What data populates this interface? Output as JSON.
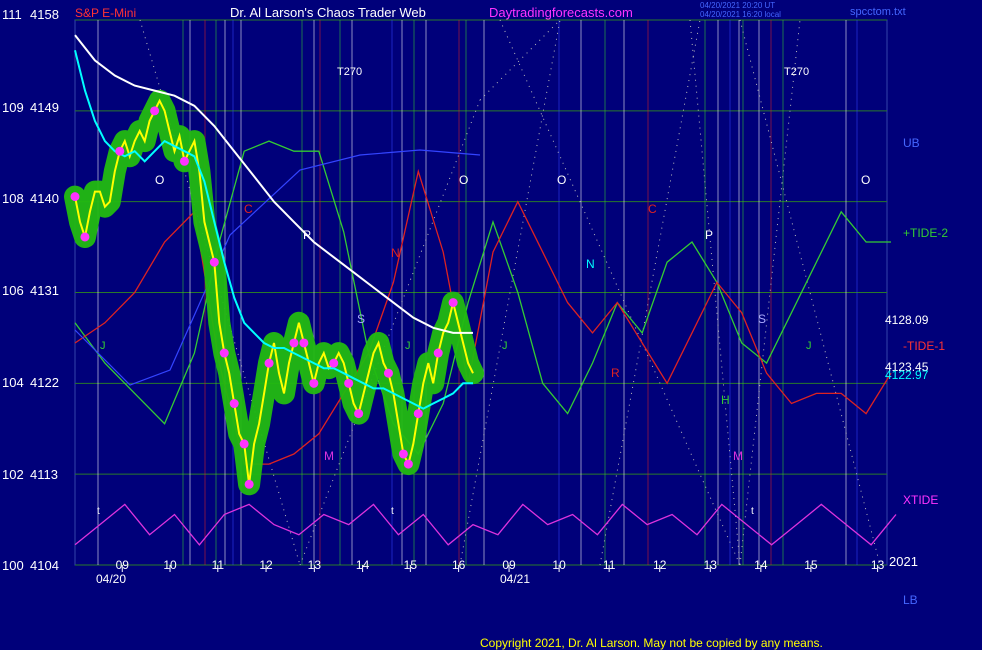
{
  "header": {
    "instrument": "S&P E-Mini",
    "site": "Dr. Al Larson's Chaos Trader Web",
    "url": "Daytradingforecasts.com",
    "timestamp1": "04/20/2021 20:20 UT",
    "timestamp2": "04/20/2021 16:20 local",
    "file": "spcctom.txt"
  },
  "footer": {
    "copyright": "Copyright 2021, Dr. Al Larson. May not be copied by any means."
  },
  "colors": {
    "background": "#00007a",
    "price_glow": "#22bb11",
    "price": "#ffff00",
    "ma_fast": "#00ffff",
    "ma_slow": "#ffffff",
    "tide_plus": "#33cc33",
    "tide_minus": "#dd2222",
    "xtide": "#dd33dd",
    "grid": "#2a7a2a",
    "blue": "#3344ff"
  },
  "chart_data": {
    "type": "line",
    "title": "S&P E-Mini",
    "y_axis": [
      {
        "label": "111",
        "price": 4158
      },
      {
        "label": "109",
        "price": 4149
      },
      {
        "label": "108",
        "price": 4140
      },
      {
        "label": "106",
        "price": 4131
      },
      {
        "label": "104",
        "price": 4122
      },
      {
        "label": "102",
        "price": 4113
      },
      {
        "label": "100",
        "price": 4104
      }
    ],
    "ylim": [
      4104,
      4158
    ],
    "xlim": [
      8.0,
      16.2
    ],
    "x_ticks": [
      "09",
      "10",
      "11",
      "12",
      "13",
      "14",
      "15",
      "16",
      "09",
      "10",
      "11",
      "12",
      "13",
      "14",
      "15",
      "13"
    ],
    "x_tick_hours": [
      8.95,
      9.91,
      10.87,
      11.84,
      12.81,
      13.78,
      14.74,
      15.71,
      8.95,
      9.91,
      10.87,
      11.84,
      12.81,
      13.78,
      14.74,
      16.02
    ],
    "x_tick_session": [
      0,
      0,
      0,
      0,
      0,
      0,
      0,
      0,
      1,
      1,
      1,
      1,
      1,
      1,
      1,
      1
    ],
    "dates": [
      "04/20",
      "04/21"
    ],
    "year": "2021",
    "right_labels": [
      "UB",
      "+TIDE-2",
      "4128.09",
      "-TIDE-1",
      "4123.45",
      "4122.97",
      "XTIDE",
      "LB"
    ],
    "markers": [
      "O",
      "O",
      "O",
      "O",
      "T270",
      "T270",
      "C",
      "C",
      "P",
      "P",
      "N",
      "N",
      "S",
      "S",
      "J",
      "J",
      "J",
      "J",
      "R",
      "H",
      "M",
      "M",
      "t",
      "t",
      "t"
    ],
    "series": [
      {
        "name": "price",
        "x": [
          8.0,
          8.1,
          8.2,
          8.3,
          8.4,
          8.5,
          8.6,
          8.7,
          8.8,
          8.9,
          9.0,
          9.1,
          9.2,
          9.3,
          9.4,
          9.5,
          9.6,
          9.7,
          9.8,
          9.9,
          10.0,
          10.1,
          10.2,
          10.3,
          10.4,
          10.5,
          10.6,
          10.7,
          10.8,
          10.9,
          11.0,
          11.1,
          11.2,
          11.3,
          11.4,
          11.5,
          11.6,
          11.7,
          11.8,
          11.9,
          12.0,
          12.1,
          12.2,
          12.3,
          12.4,
          12.5,
          12.6,
          12.7,
          12.8,
          12.9,
          13.0,
          13.1,
          13.2,
          13.3,
          13.4,
          13.5,
          13.6,
          13.7,
          13.8,
          13.9,
          14.0,
          14.1,
          14.2,
          14.3,
          14.4,
          14.5,
          14.6,
          14.7,
          14.8,
          14.9,
          15.0,
          15.1,
          15.2,
          15.3,
          15.4,
          15.5,
          15.6,
          15.7,
          15.8,
          15.9,
          16.0
        ],
        "values": [
          4140.5,
          4138,
          4136.5,
          4139,
          4141,
          4141,
          4139.5,
          4140,
          4143,
          4145,
          4146,
          4144.5,
          4146,
          4147,
          4146,
          4148,
          4149,
          4150,
          4149,
          4147,
          4145,
          4146.5,
          4144,
          4145,
          4146,
          4143,
          4138,
          4136,
          4134,
          4128,
          4125,
          4123,
          4120,
          4117,
          4116,
          4112,
          4116,
          4118,
          4121,
          4124,
          4126,
          4123,
          4121,
          4124,
          4126,
          4128,
          4126,
          4124,
          4122,
          4124,
          4125,
          4123.5,
          4124,
          4125,
          4124,
          4122,
          4120,
          4119,
          4121,
          4123,
          4125,
          4126,
          4124,
          4123,
          4121,
          4118,
          4115,
          4114,
          4116,
          4119,
          4122,
          4124,
          4122,
          4125,
          4127,
          4128,
          4130,
          4128,
          4126,
          4124,
          4123
        ]
      },
      {
        "name": "fast moving average",
        "x": [
          8.0,
          8.2,
          8.4,
          8.6,
          8.8,
          9.0,
          9.2,
          9.4,
          9.6,
          9.8,
          10.0,
          10.2,
          10.4,
          10.6,
          10.8,
          11.0,
          11.2,
          11.4,
          11.6,
          11.8,
          12.0,
          12.2,
          12.4,
          12.6,
          12.8,
          13.0,
          13.2,
          13.4,
          13.6,
          13.8,
          14.0,
          14.2,
          14.4,
          14.6,
          14.8,
          15.0,
          15.2,
          15.4,
          15.6,
          15.8,
          16.0
        ],
        "values": [
          4155,
          4151,
          4148,
          4146,
          4145,
          4144.5,
          4145,
          4144,
          4145,
          4146,
          4145.5,
          4145,
          4144.5,
          4142,
          4138,
          4134,
          4130.5,
          4128,
          4127,
          4126,
          4125.5,
          4125.5,
          4125,
          4124.5,
          4124,
          4123.5,
          4123.5,
          4123,
          4122.5,
          4122,
          4121.5,
          4121.5,
          4121,
          4120.5,
          4120,
          4119.5,
          4120,
          4120.5,
          4121,
          4122,
          4122
        ]
      },
      {
        "name": "slow moving average",
        "x": [
          8.0,
          8.4,
          8.8,
          9.2,
          9.6,
          10.0,
          10.4,
          10.8,
          11.2,
          11.6,
          12.0,
          12.4,
          12.8,
          13.2,
          13.6,
          14.0,
          14.4,
          14.8,
          15.2,
          15.6,
          16.0
        ],
        "values": [
          4156.5,
          4154,
          4152.5,
          4151.5,
          4151,
          4150.5,
          4149.5,
          4147.5,
          4145,
          4142.5,
          4140,
          4138,
          4136,
          4134.5,
          4133,
          4131.5,
          4130,
          4128.5,
          4127.5,
          4127,
          4127
        ]
      },
      {
        "name": "+TIDE-2",
        "x": [
          8.0,
          8.6,
          9.2,
          9.8,
          10.4,
          10.9,
          11.4,
          11.9,
          12.4,
          12.9,
          13.4,
          13.9,
          14.4,
          14.9,
          15.4,
          15.9,
          16.4,
          16.9,
          17.4,
          17.9,
          18.4,
          18.9,
          19.4,
          19.9,
          20.4,
          20.9,
          21.4,
          21.9,
          22.4,
          22.9,
          23.4,
          23.9,
          24.4
        ],
        "values": [
          4128,
          4124,
          4121,
          4118,
          4125,
          4136,
          4145,
          4146,
          4145,
          4145,
          4137,
          4125,
          4118,
          4115,
          4120,
          4130,
          4138,
          4131,
          4122,
          4119,
          4124,
          4130,
          4127,
          4134,
          4136,
          4132,
          4126,
          4124,
          4129,
          4134,
          4139,
          4136,
          4136
        ]
      },
      {
        "name": "-TIDE-1",
        "x": [
          8.0,
          8.6,
          9.2,
          9.8,
          10.4,
          10.9,
          11.4,
          11.9,
          12.4,
          12.9,
          13.4,
          13.9,
          14.4,
          14.9,
          15.4,
          15.9,
          16.4,
          16.9,
          17.4,
          17.9,
          18.4,
          18.9,
          19.4,
          19.9,
          20.4,
          20.9,
          21.4,
          21.9,
          22.4,
          22.9,
          23.4,
          23.9,
          24.4
        ],
        "values": [
          4126,
          4128,
          4131,
          4136,
          4139,
          4124,
          4114,
          4114,
          4115,
          4117,
          4121,
          4125,
          4132,
          4143,
          4135,
          4122,
          4135,
          4140,
          4135,
          4130,
          4127,
          4130,
          4126,
          4122,
          4127,
          4132,
          4129,
          4123,
          4120,
          4121,
          4121,
          4119,
          4123
        ]
      },
      {
        "name": "XTIDE",
        "x": [
          8.0,
          8.5,
          9.0,
          9.5,
          10.0,
          10.5,
          11.0,
          11.5,
          12.0,
          12.5,
          13.0,
          13.5,
          14.0,
          14.5,
          15.0,
          15.5,
          16.0,
          16.5,
          17.0,
          17.5,
          18.0,
          18.5,
          19.0,
          19.5,
          20.0,
          20.5,
          21.0,
          21.5,
          22.0,
          22.5,
          23.0,
          23.5,
          24.0,
          24.5
        ],
        "values": [
          4106,
          4108,
          4110,
          4107,
          4109,
          4106,
          4109,
          4110,
          4108,
          4107,
          4109,
          4108,
          4110,
          4107,
          4109,
          4106,
          4108,
          4107,
          4110,
          4108,
          4109,
          4107,
          4110,
          4108,
          4109,
          4107,
          4110,
          4108,
          4106,
          4108,
          4110,
          4108,
          4106,
          4109
        ]
      }
    ]
  }
}
